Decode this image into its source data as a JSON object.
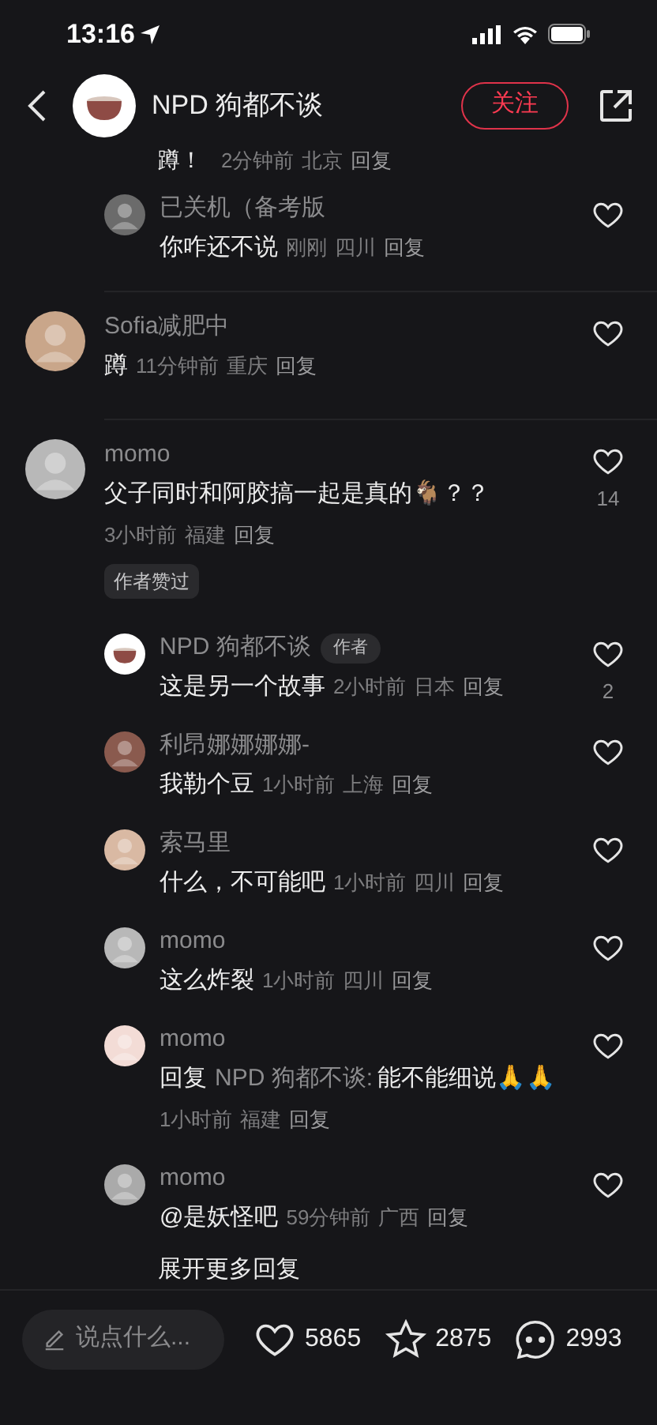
{
  "status_bar": {
    "time": "13:16"
  },
  "header": {
    "title": "NPD 狗都不谈",
    "follow_button": "关注"
  },
  "partial_comment": {
    "text": "蹲！",
    "time": "2分钟前",
    "location": "北京",
    "reply_label": "回复"
  },
  "threads": [
    {
      "kind": "reply",
      "name": "已关机（备考版",
      "text": "你咋还不说",
      "time": "刚刚",
      "location": "四川",
      "reply_label": "回复"
    },
    {
      "kind": "top",
      "name": "Sofia减肥中",
      "text": "蹲",
      "time": "11分钟前",
      "location": "重庆",
      "reply_label": "回复",
      "divider_before": true
    },
    {
      "kind": "top",
      "name": "momo",
      "text": "父子同时和阿胶搞一起是真的🐐？？",
      "time": "3小时前",
      "location": "福建",
      "reply_label": "回复",
      "likes": "14",
      "tag": "作者赞过",
      "divider_before": true
    },
    {
      "kind": "author_reply",
      "name": "NPD 狗都不谈",
      "badge": "作者",
      "text": "这是另一个故事",
      "time": "2小时前",
      "location": "日本",
      "reply_label": "回复",
      "likes": "2"
    },
    {
      "kind": "reply",
      "name": "利昂娜娜娜娜-",
      "text": "我勒个豆",
      "time": "1小时前",
      "location": "上海",
      "reply_label": "回复"
    },
    {
      "kind": "reply",
      "name": "索马里",
      "text": "什么，不可能吧",
      "time": "1小时前",
      "location": "四川",
      "reply_label": "回复"
    },
    {
      "kind": "reply",
      "name": "momo",
      "text": "这么炸裂",
      "time": "1小时前",
      "location": "四川",
      "reply_label": "回复"
    },
    {
      "kind": "reply",
      "name": "momo",
      "reply_prefix": "回复",
      "reply_target": "NPD 狗都不谈:",
      "text": "能不能细说🙏🙏",
      "time": "1小时前",
      "location": "福建",
      "reply_label": "回复"
    },
    {
      "kind": "reply",
      "name": "momo",
      "text": "@是妖怪吧",
      "time": "59分钟前",
      "location": "广西",
      "reply_label": "回复"
    }
  ],
  "expand_more": "展开更多回复",
  "bottom_bar": {
    "placeholder": "说点什么...",
    "likes": "5865",
    "favorites": "2875",
    "comments": "2993"
  }
}
